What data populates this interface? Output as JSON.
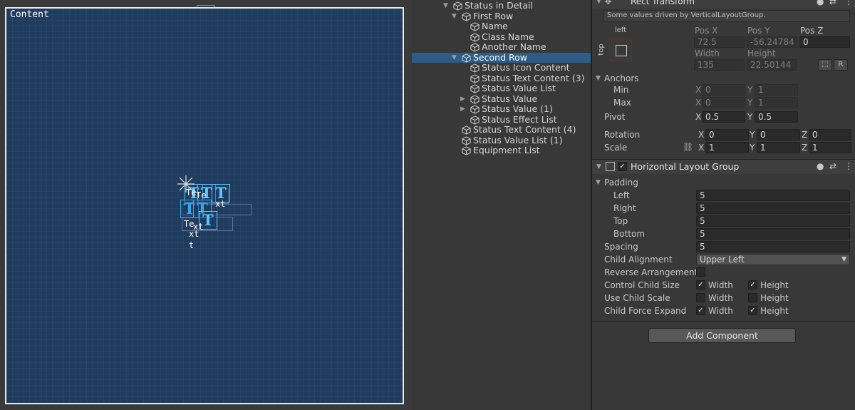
{
  "scene": {
    "canvas_label": "Content",
    "icons": [
      "text-component-icon",
      "gizmo-icon"
    ],
    "fragments": [
      "Te",
      "xt",
      "Te",
      "xt",
      "xt",
      "t",
      "Te"
    ]
  },
  "hierarchy": {
    "items": [
      {
        "label": "Status in Detail",
        "depth": 0,
        "expanded": true
      },
      {
        "label": "First Row",
        "depth": 1,
        "expanded": true
      },
      {
        "label": "Name",
        "depth": 2
      },
      {
        "label": "Class Name",
        "depth": 2
      },
      {
        "label": "Another Name",
        "depth": 2
      },
      {
        "label": "Second Row",
        "depth": 1,
        "expanded": true,
        "selected": true
      },
      {
        "label": "Status Icon Content",
        "depth": 2
      },
      {
        "label": "Status Text Content (3)",
        "depth": 2
      },
      {
        "label": "Status Value List",
        "depth": 2
      },
      {
        "label": "Status Value",
        "depth": 2,
        "collapsed": true
      },
      {
        "label": "Status Value (1)",
        "depth": 2,
        "collapsed": true
      },
      {
        "label": "Status Effect List",
        "depth": 2
      },
      {
        "label": "Status Text Content (4)",
        "depth": 1
      },
      {
        "label": "Status Value List (1)",
        "depth": 1
      },
      {
        "label": "Equipment List",
        "depth": 1
      }
    ]
  },
  "inspector": {
    "rect_transform": {
      "title": "Rect Transform",
      "driven_note": "Some values driven by VerticalLayoutGroup.",
      "anchor_h": "left",
      "anchor_v": "top",
      "pos_x_label": "Pos X",
      "pos_y_label": "Pos Y",
      "pos_z_label": "Pos Z",
      "pos_x": "72.5",
      "pos_y": "-56.24784",
      "pos_z": "0",
      "width_label": "Width",
      "height_label": "Height",
      "width": "135",
      "height": "22.50144",
      "r_button": "R",
      "anchors_label": "Anchors",
      "min_label": "Min",
      "max_label": "Max",
      "min_x": "0",
      "min_y": "1",
      "max_x": "0",
      "max_y": "1",
      "pivot_label": "Pivot",
      "pivot_x": "0.5",
      "pivot_y": "0.5",
      "rotation_label": "Rotation",
      "rot_x": "0",
      "rot_y": "0",
      "rot_z": "0",
      "scale_label": "Scale",
      "scale_x": "1",
      "scale_y": "1",
      "scale_z": "1",
      "axis_x": "X",
      "axis_y": "Y",
      "axis_z": "Z"
    },
    "hlg": {
      "title": "Horizontal Layout Group",
      "enabled": true,
      "padding_label": "Padding",
      "left_label": "Left",
      "left": "5",
      "right_label": "Right",
      "right": "5",
      "top_label": "Top",
      "top": "5",
      "bottom_label": "Bottom",
      "bottom": "5",
      "spacing_label": "Spacing",
      "spacing": "5",
      "child_alignment_label": "Child Alignment",
      "child_alignment": "Upper Left",
      "reverse_label": "Reverse Arrangement",
      "reverse": false,
      "control_child_size_label": "Control Child Size",
      "use_child_scale_label": "Use Child Scale",
      "child_force_expand_label": "Child Force Expand",
      "width_label": "Width",
      "height_label": "Height",
      "control_width": true,
      "control_height": true,
      "scale_width": false,
      "scale_height": false,
      "expand_width": true,
      "expand_height": true
    },
    "add_component": "Add Component"
  }
}
